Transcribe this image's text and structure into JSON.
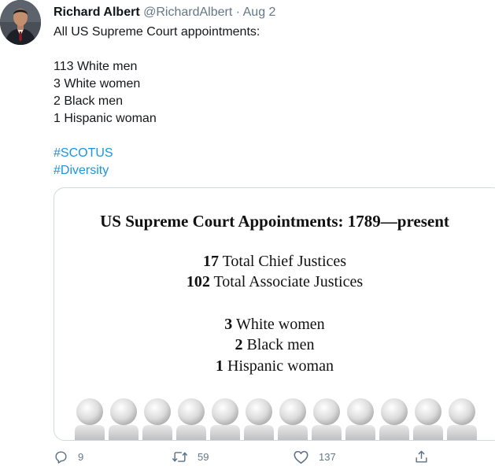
{
  "tweet": {
    "author": {
      "display_name": "Richard Albert",
      "handle": "@RichardAlbert",
      "separator": "·",
      "date": "Aug 2"
    },
    "text_lines": [
      "All US Supreme Court appointments:",
      "",
      "113 White men",
      "3 White women",
      "2 Black men",
      "1 Hispanic woman",
      ""
    ],
    "hashtags": [
      "#SCOTUS",
      "#Diversity"
    ],
    "media": {
      "title": "US Supreme Court Appointments: 1789—present",
      "stats": [
        {
          "num": "17",
          "label": "Total Chief Justices"
        },
        {
          "num": "102",
          "label": "Total Associate Justices"
        },
        {
          "num": "3",
          "label": "White women"
        },
        {
          "num": "2",
          "label": "Black men"
        },
        {
          "num": "1",
          "label": "Hispanic woman"
        }
      ],
      "figure_icon": "person-figure-icon",
      "figure_count": 12
    },
    "actions": {
      "reply": {
        "icon": "reply-icon",
        "count": "9"
      },
      "retweet": {
        "icon": "retweet-icon",
        "count": "59"
      },
      "like": {
        "icon": "heart-icon",
        "count": "137"
      },
      "share": {
        "icon": "share-icon"
      }
    },
    "colors": {
      "link": "#1b95e0",
      "secondary_text": "#657786",
      "primary_text": "#0f1419",
      "card_border": "#cfd9de"
    }
  }
}
